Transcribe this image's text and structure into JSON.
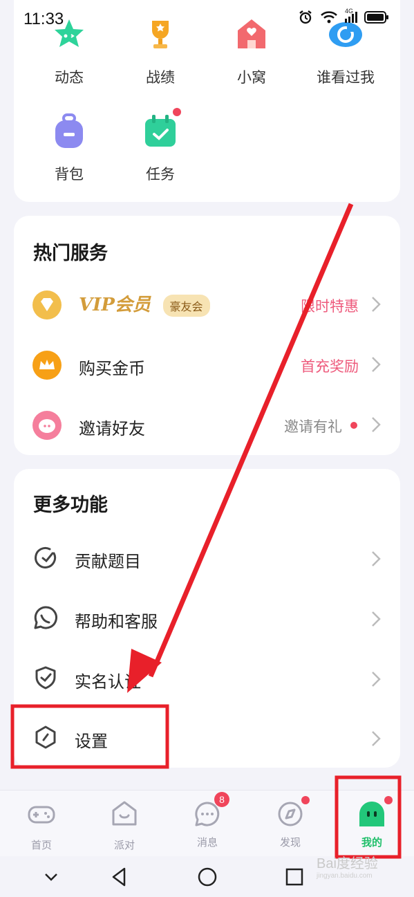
{
  "status_bar": {
    "time": "11:33",
    "network": "4G"
  },
  "quick_grid": [
    {
      "label": "动态",
      "icon": "star-icon"
    },
    {
      "label": "战绩",
      "icon": "trophy-icon"
    },
    {
      "label": "小窝",
      "icon": "house-icon"
    },
    {
      "label": "谁看过我",
      "icon": "eye-icon"
    },
    {
      "label": "背包",
      "icon": "backpack-icon"
    },
    {
      "label": "任务",
      "icon": "calendar-icon"
    }
  ],
  "hot_services": {
    "title": "热门服务",
    "items": [
      {
        "label": "VIP会员",
        "badge": "豪友会",
        "right": "限时特惠",
        "icon": "diamond-icon"
      },
      {
        "label": "购买金币",
        "right": "首充奖励",
        "icon": "crown-icon"
      },
      {
        "label": "邀请好友",
        "right": "邀请有礼",
        "icon": "pig-icon"
      }
    ]
  },
  "more_functions": {
    "title": "更多功能",
    "items": [
      {
        "label": "贡献题目",
        "icon": "contribute-icon"
      },
      {
        "label": "帮助和客服",
        "icon": "chat-icon"
      },
      {
        "label": "实名认证",
        "icon": "shield-check-icon"
      },
      {
        "label": "设置",
        "icon": "settings-hexagon-icon"
      }
    ]
  },
  "tabs": [
    {
      "label": "首页",
      "icon": "gamepad-icon"
    },
    {
      "label": "派对",
      "icon": "party-house-icon"
    },
    {
      "label": "消息",
      "icon": "message-icon",
      "badge": "8"
    },
    {
      "label": "发现",
      "icon": "compass-icon"
    },
    {
      "label": "我的",
      "icon": "me-face-icon"
    }
  ],
  "watermark": {
    "text": "Bai度经验",
    "sub": "jingyan.baidu.com"
  },
  "colors": {
    "accent_green": "#1fbf6a",
    "promo_pink": "#ee5a7c",
    "annotation_red": "#e8202a"
  }
}
